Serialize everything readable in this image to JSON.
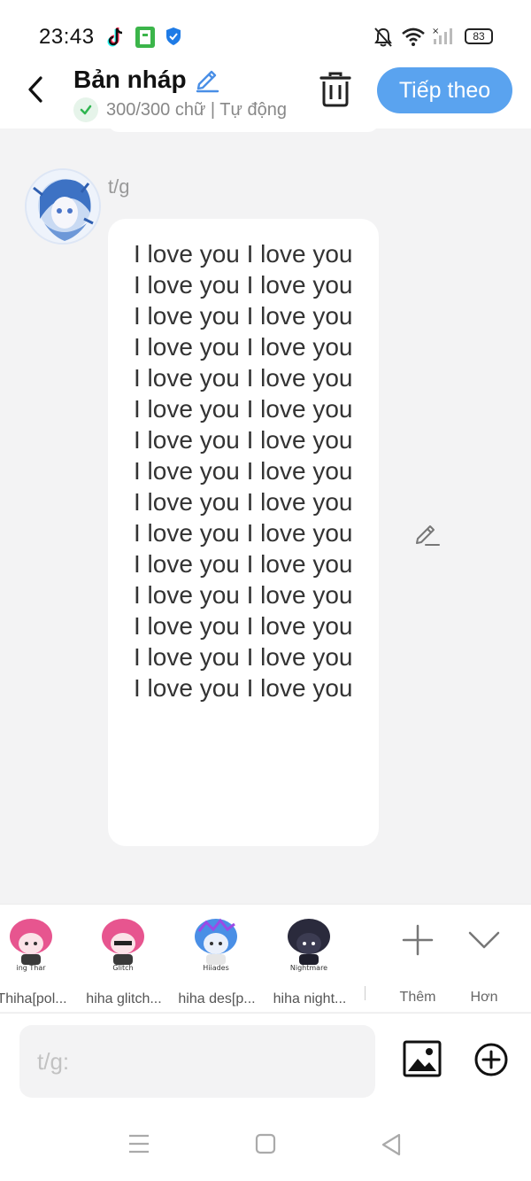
{
  "status_bar": {
    "time": "23:43",
    "battery": "83",
    "icons": [
      "tiktok-icon",
      "app-icon",
      "shield-icon",
      "mute-bell-icon",
      "wifi-icon",
      "signal-icon",
      "battery-icon"
    ]
  },
  "header": {
    "title": "Bản nháp",
    "subtitle": "300/300 chữ | Tự động",
    "next_label": "Tiếp theo"
  },
  "chat": {
    "sender": "t/g",
    "message": "I love you I love you I love you I love you I love you I love you I love you I love you I love you I love you I love you I love you I love you I love you I love you I love you I love you I love you I love you I love you I love you I love you I love you I love you I love you I love you I love you I love you I love you I love you"
  },
  "characters": [
    {
      "label": "Thiha[pol...",
      "sticker_text": "ing Thar",
      "hair": "#e7558f"
    },
    {
      "label": "hiha glitch...",
      "sticker_text": "Glitch",
      "hair": "#e7558f"
    },
    {
      "label": "hiha des[p...",
      "sticker_text": "Hiiades",
      "hair": "#4a8fe6"
    },
    {
      "label": "hiha night...",
      "sticker_text": "Nightmare",
      "hair": "#2a2a3c"
    }
  ],
  "actions": {
    "more_label": "Thêm",
    "less_label": "Hơn"
  },
  "input": {
    "placeholder": "t/g:"
  },
  "colors": {
    "accent": "#5aa3ef",
    "background": "#f3f3f4",
    "bubble": "#ffffff",
    "check": "#2fb550"
  }
}
